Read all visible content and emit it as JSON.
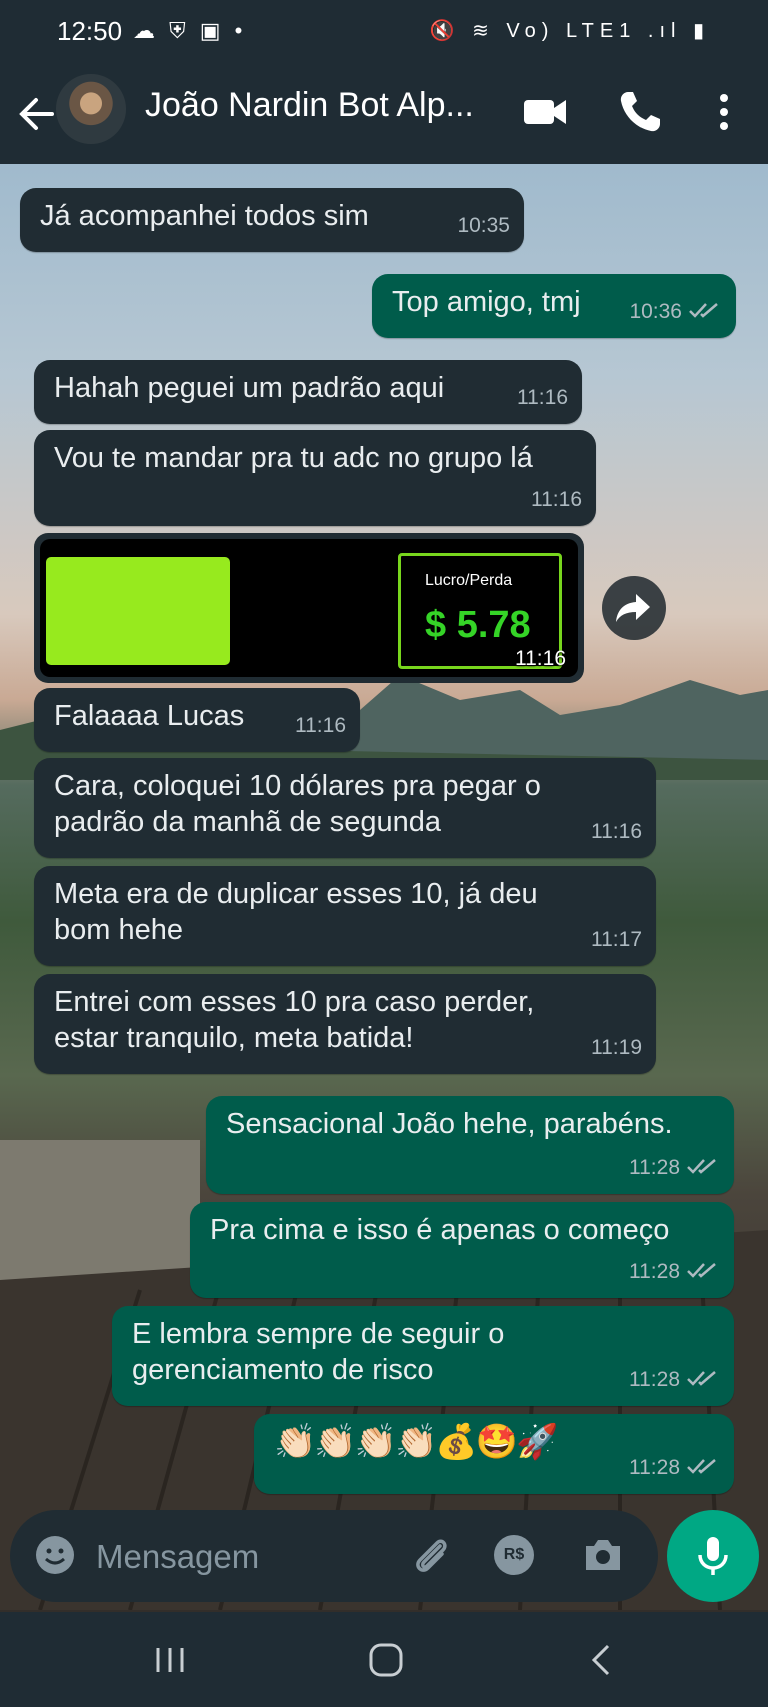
{
  "status_bar": {
    "time": "12:50",
    "left_icons": "☁ ⛨ ▣ •",
    "right_icons": "🔇 ≋ Vo) LTE1 .ıl ▮"
  },
  "header": {
    "contact_name": "João Nardin Bot Alp..."
  },
  "messages": [
    {
      "dir": "in",
      "text": "Já acompanhei todos sim",
      "time": "10:35"
    },
    {
      "dir": "out",
      "text": "Top amigo, tmj",
      "time": "10:36"
    },
    {
      "dir": "in",
      "text": "Hahah peguei um padrão aqui",
      "time": "11:16"
    },
    {
      "dir": "in",
      "text": "Vou te mandar pra tu adc no grupo lá",
      "time": "11:16"
    },
    {
      "dir": "in",
      "text": "Falaaaa Lucas",
      "time": "11:16"
    },
    {
      "dir": "in",
      "line1": "Cara, coloquei 10 dólares pra pegar o",
      "line2": "padrão da manhã de segunda",
      "time": "11:16"
    },
    {
      "dir": "in",
      "line1": "Meta era de duplicar esses 10, já deu",
      "line2": "bom hehe",
      "time": "11:17"
    },
    {
      "dir": "in",
      "line1": "Entrei com esses 10 pra caso perder,",
      "line2": "estar tranquilo, meta batida!",
      "time": "11:19"
    },
    {
      "dir": "out",
      "text": "Sensacional João hehe, parabéns.",
      "time": "11:28"
    },
    {
      "dir": "out",
      "text": "Pra cima e isso é apenas o começo",
      "time": "11:28"
    },
    {
      "dir": "out",
      "line1": "E lembra sempre de seguir o",
      "line2": "gerenciamento de risco",
      "time": "11:28"
    },
    {
      "dir": "out",
      "text": "👏🏻👏🏻👏🏻👏🏻💰🤩🚀",
      "time": "11:28"
    }
  ],
  "image_message": {
    "label": "Lucro/Perda",
    "value": "$ 5.78",
    "time": "11:16"
  },
  "compose": {
    "placeholder": "Mensagem",
    "currency_icon_text": "R$"
  },
  "colors": {
    "incoming": "#202c33",
    "outgoing": "#005c4b",
    "accent": "#00a884",
    "bar": "#1f2c34"
  }
}
